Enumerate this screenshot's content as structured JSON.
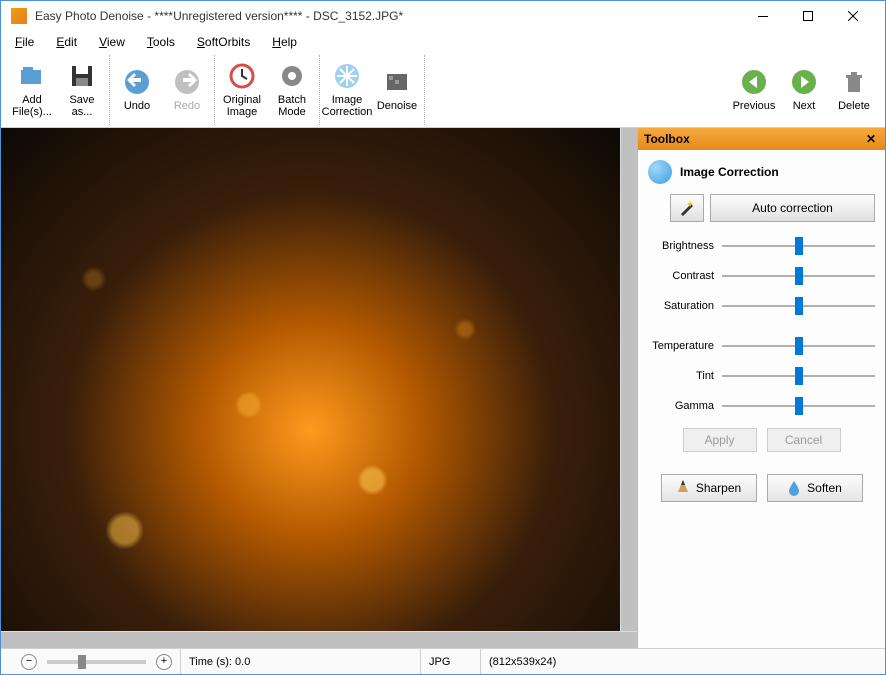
{
  "title": "Easy Photo Denoise - ****Unregistered version**** - DSC_3152.JPG*",
  "menubar": [
    {
      "label": "File",
      "u": 0
    },
    {
      "label": "Edit",
      "u": 0
    },
    {
      "label": "View",
      "u": 0
    },
    {
      "label": "Tools",
      "u": 0
    },
    {
      "label": "SoftOrbits",
      "u": 0
    },
    {
      "label": "Help",
      "u": 0
    }
  ],
  "toolbar": {
    "left": [
      {
        "name": "add-files",
        "label": "Add File(s)...",
        "icon": "add-files-icon"
      },
      {
        "name": "save-as",
        "label": "Save as...",
        "icon": "save-icon"
      }
    ],
    "edit": [
      {
        "name": "undo",
        "label": "Undo",
        "icon": "undo-icon"
      },
      {
        "name": "redo",
        "label": "Redo",
        "icon": "redo-icon",
        "disabled": true
      }
    ],
    "view": [
      {
        "name": "original-image",
        "label": "Original Image",
        "icon": "clock-icon"
      },
      {
        "name": "batch-mode",
        "label": "Batch Mode",
        "icon": "gear-icon"
      }
    ],
    "process": [
      {
        "name": "image-correction",
        "label": "Image Correction",
        "icon": "snowflake-icon"
      },
      {
        "name": "denoise",
        "label": "Denoise",
        "icon": "denoise-icon"
      }
    ],
    "nav": [
      {
        "name": "previous",
        "label": "Previous",
        "icon": "prev-icon"
      },
      {
        "name": "next",
        "label": "Next",
        "icon": "next-icon"
      },
      {
        "name": "delete",
        "label": "Delete",
        "icon": "trash-icon"
      }
    ]
  },
  "toolbox": {
    "title": "Toolbox",
    "section": "Image Correction",
    "auto_btn": "Auto correction",
    "sliders1": [
      "Brightness",
      "Contrast",
      "Saturation"
    ],
    "sliders2": [
      "Temperature",
      "Tint",
      "Gamma"
    ],
    "apply": "Apply",
    "cancel": "Cancel",
    "sharpen": "Sharpen",
    "soften": "Soften"
  },
  "status": {
    "time": "Time (s): 0.0",
    "format": "JPG",
    "dimensions": "(812x539x24)"
  }
}
